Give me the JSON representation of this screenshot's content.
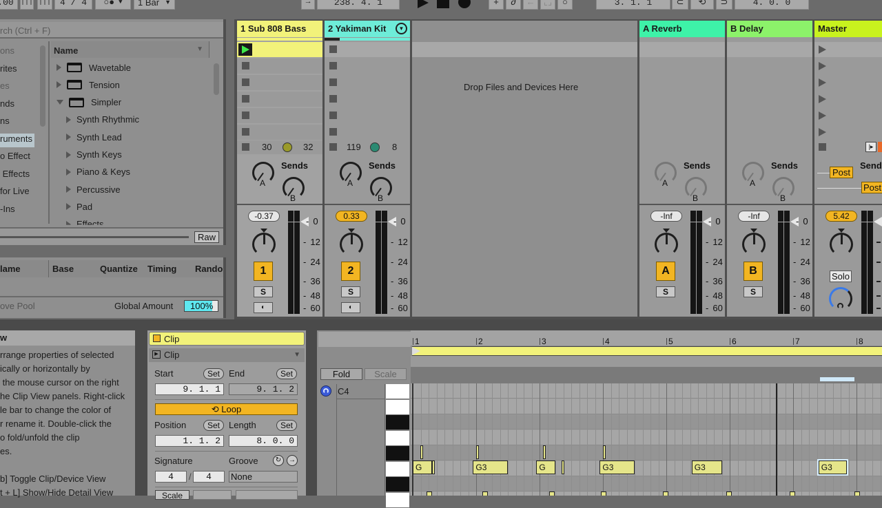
{
  "toolbar": {
    "tempo_fraction": ".00",
    "time_signature": "4 / 4",
    "metronome_icons": "○●",
    "quantize": "1 Bar",
    "song_position": "238. 4. 1",
    "loop_start": "3. 1. 1",
    "loop_length": "4. 0. 0"
  },
  "browser": {
    "search_placeholder": "rch (Ctrl + F)",
    "categories": [
      {
        "label": "ons",
        "dim": true
      },
      {
        "label": "rites",
        "dim": false
      },
      {
        "label": "es",
        "dim": true
      },
      {
        "label": "nds",
        "dim": false
      },
      {
        "label": "ns",
        "dim": false
      },
      {
        "label": "ruments",
        "dim": false,
        "selected": true
      },
      {
        "label": "o Effect",
        "dim": false
      },
      {
        "label": " Effects",
        "dim": false
      },
      {
        "label": "for Live",
        "dim": false
      },
      {
        "label": "-Ins",
        "dim": false
      }
    ],
    "column_header": "Name",
    "items": [
      {
        "label": "Wavetable",
        "type": "device",
        "expanded": false
      },
      {
        "label": "Tension",
        "type": "device",
        "expanded": false
      },
      {
        "label": "Simpler",
        "type": "device",
        "expanded": true
      },
      {
        "label": "Synth Rhythmic",
        "type": "folder",
        "expanded": false
      },
      {
        "label": "Synth Lead",
        "type": "folder",
        "expanded": false
      },
      {
        "label": "Synth Keys",
        "type": "folder",
        "expanded": false
      },
      {
        "label": "Piano & Keys",
        "type": "folder",
        "expanded": false
      },
      {
        "label": "Percussive",
        "type": "folder",
        "expanded": false
      },
      {
        "label": "Pad",
        "type": "folder",
        "expanded": false
      },
      {
        "label": "Effects",
        "type": "folder",
        "expanded": false
      }
    ],
    "raw_button": "Raw"
  },
  "groove_pool": {
    "columns": [
      "lame",
      "Base",
      "Quantize",
      "Timing",
      "Rando"
    ],
    "footer_label": "ove Pool",
    "global_amount_label": "Global Amount",
    "global_amount_value": "100%"
  },
  "tracks": [
    {
      "name": "1 Sub 808 Bass",
      "color": "#f2f27a",
      "volume": "-0.37",
      "volume_active": false,
      "number": "1",
      "solo": "S",
      "clip_info_left": "30",
      "clip_info_right": "32",
      "knob_color": "#9a9a2a",
      "sends_label": "Sends",
      "send_a": "A",
      "send_b": "B"
    },
    {
      "name": "2 Yakiman Kit",
      "color": "#6eecd8",
      "volume": "0.33",
      "volume_active": true,
      "number": "2",
      "solo": "S",
      "clip_info_left": "119",
      "clip_info_right": "8",
      "knob_color": "#2a8a72",
      "sends_label": "Sends",
      "send_a": "A",
      "send_b": "B"
    }
  ],
  "drop_area": "Drop Files and Devices Here",
  "returns": [
    {
      "name": "A Reverb",
      "color": "#3ef2a8",
      "volume": "-Inf",
      "letter": "A",
      "solo": "S",
      "sends_label": "Sends",
      "send_a": "A",
      "send_b": "B"
    },
    {
      "name": "B Delay",
      "color": "#8cf26a",
      "volume": "-Inf",
      "letter": "B",
      "solo": "S",
      "sends_label": "Sends",
      "send_a": "A",
      "send_b": "B"
    }
  ],
  "master": {
    "name": "Master",
    "color": "#c8f21e",
    "volume": "5.42",
    "sends_label": "Sends",
    "post_a": "Post",
    "post_b": "Post",
    "solo": "Solo"
  },
  "meter_scale": [
    "0",
    "12",
    "24",
    "36",
    "48",
    "60"
  ],
  "info_view": {
    "title": "w",
    "lines": [
      "rrange properties of selected",
      "ically or horizontally by",
      " the mouse cursor on the right",
      "he Clip View panels. Right-click",
      "le bar to change the color of",
      "r rename it. Double-click the",
      "o fold/unfold the clip",
      "es.",
      "",
      "b] Toggle Clip/Device View",
      "t + L] Show/Hide Detail View"
    ]
  },
  "clip_view": {
    "title": "Clip",
    "section": "Clip",
    "start_label": "Start",
    "end_label": "End",
    "set_label": "Set",
    "start_value": "9.  1.  1",
    "end_value": "9.  1.  2",
    "loop_label": "Loop",
    "position_label": "Position",
    "length_label": "Length",
    "position_value": "1.  1.  2",
    "length_value": "8.  0.  0",
    "signature_label": "Signature",
    "groove_label": "Groove",
    "sig_num": "4",
    "sig_den": "4",
    "groove_value": "None",
    "scale_label": "Scale"
  },
  "midi_editor": {
    "fold_label": "Fold",
    "scale_label": "Scale",
    "key_label": "C4",
    "ruler": [
      "1",
      "2",
      "3",
      "4",
      "5",
      "6",
      "7",
      "8"
    ],
    "notes": [
      {
        "label": "G",
        "bar": 1.0,
        "len": 0.3,
        "row": "g3"
      },
      {
        "label": "G3",
        "bar": 1.95,
        "len": 0.55,
        "row": "g3"
      },
      {
        "label": "G",
        "bar": 2.95,
        "len": 0.3,
        "row": "g3"
      },
      {
        "label": "G3",
        "bar": 3.95,
        "len": 0.55,
        "row": "g3"
      },
      {
        "label": "G3",
        "bar": 5.4,
        "len": 0.48,
        "row": "g3"
      },
      {
        "label": "G3",
        "bar": 7.4,
        "len": 0.45,
        "row": "g3",
        "selected": true
      }
    ]
  }
}
